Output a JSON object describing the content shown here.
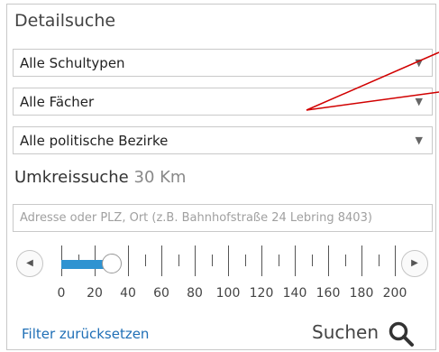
{
  "title": "Detailsuche",
  "selects": {
    "school_type": "Alle Schultypen",
    "subject": "Alle Fächer",
    "district": "Alle politische Bezirke"
  },
  "radius": {
    "label": "Umkreissuche",
    "value": "30 Km"
  },
  "address": {
    "placeholder": "Adresse oder PLZ, Ort (z.B. Bahnhofstraße 24 Lebring 8403)"
  },
  "slider": {
    "min": 0,
    "max": 200,
    "value": 30,
    "labels": [
      "0",
      "20",
      "40",
      "60",
      "80",
      "100",
      "120",
      "140",
      "160",
      "180",
      "200"
    ]
  },
  "icons": {
    "prev": "chevron-left-icon",
    "next": "chevron-right-icon",
    "search": "magnifier-icon",
    "dropdown": "triangle-down-icon"
  },
  "actions": {
    "reset": "Filter zurücksetzen",
    "search": "Suchen"
  },
  "colors": {
    "accent": "#2f93d1",
    "link": "#1f6fb6",
    "annotation": "#d10000"
  }
}
